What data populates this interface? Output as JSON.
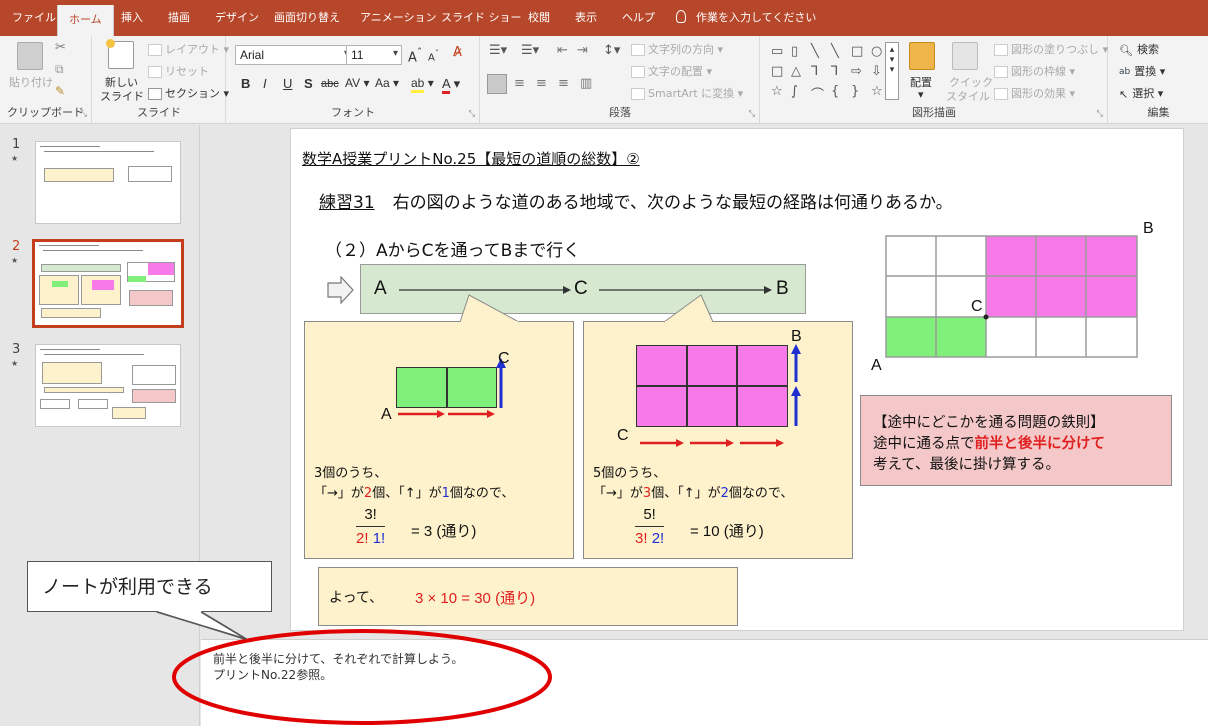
{
  "tabs": [
    {
      "label": "ファイル",
      "active": false
    },
    {
      "label": "ホーム",
      "active": true
    },
    {
      "label": "挿入",
      "active": false
    },
    {
      "label": "描画",
      "active": false
    },
    {
      "label": "デザイン",
      "active": false
    },
    {
      "label": "画面切り替え",
      "active": false
    },
    {
      "label": "アニメーション",
      "active": false
    },
    {
      "label": "スライド ショー",
      "active": false
    },
    {
      "label": "校閲",
      "active": false
    },
    {
      "label": "表示",
      "active": false
    },
    {
      "label": "ヘルプ",
      "active": false
    }
  ],
  "tell_me": "作業を入力してください",
  "ribbon": {
    "clipboard": {
      "label": "クリップボード",
      "paste": "貼り付け"
    },
    "slides": {
      "label": "スライド",
      "new_slide_1": "新しい",
      "new_slide_2": "スライド",
      "layout": "レイアウト",
      "reset": "リセット",
      "section": "セクション"
    },
    "font": {
      "label": "フォント",
      "name": "Arial",
      "size": "11",
      "b": "B",
      "i": "I",
      "u": "U",
      "s": "S",
      "abc": "abc",
      "spacing": "AV",
      "case": "Aa",
      "grow": "A",
      "shrink": "A",
      "color_a": "A"
    },
    "paragraph": {
      "label": "段落",
      "text_direction": "文字列の方向",
      "align_text": "文字の配置",
      "smartart": "SmartArt に変換"
    },
    "drawing": {
      "label": "図形描画",
      "arrange_1": "配置",
      "quick_1": "クイック",
      "quick_2": "スタイル",
      "fill": "図形の塗りつぶし",
      "outline": "図形の枠線",
      "effects": "図形の効果"
    },
    "editing": {
      "label": "編集",
      "find": "検索",
      "replace": "置換",
      "select": "選択"
    }
  },
  "thumbnails": [
    {
      "number": "1",
      "star": "★"
    },
    {
      "number": "2",
      "star": "★"
    },
    {
      "number": "3",
      "star": "★"
    }
  ],
  "slide": {
    "title": "数学A授業プリントNo.25【最短の道順の総数】②",
    "exercise_no": "練習31",
    "exercise_text": "右の図のような道のある地域で、次のような最短の経路は何通りあるか。",
    "sub_question": "（２）AからCを通ってBまで行く",
    "route": {
      "a": "A",
      "c": "C",
      "b": "B"
    },
    "left_box": {
      "label_c": "C",
      "label_a": "A",
      "line1": "3個のうち、",
      "line2_a": "「→」が",
      "line2_n1": "2",
      "line2_b": "個、「↑」が",
      "line2_n2": "1",
      "line2_c": "個なので、",
      "frac_num": "3!",
      "frac_den_1": "2!",
      "frac_den_2": "1!",
      "result": "= 3 (通り)"
    },
    "right_box": {
      "label_b": "B",
      "label_c": "C",
      "line1": "5個のうち、",
      "line2_a": "「→」が",
      "line2_n1": "3",
      "line2_b": "個、「↑」が",
      "line2_n2": "2",
      "line2_c": "個なので、",
      "frac_num": "5!",
      "frac_den_1": "3!",
      "frac_den_2": "2!",
      "result": "= 10 (通り)"
    },
    "grid": {
      "label_a": "A",
      "label_b": "B",
      "label_c": "C"
    },
    "rule": {
      "title": "【途中にどこかを通る問題の鉄則】",
      "line1_a": "途中に通る点で",
      "line1_b": "前半と後半に分けて",
      "line2": "考えて、最後に掛け算する。"
    },
    "conclusion": {
      "prefix": "よって、",
      "formula": "3 × 10 = 30 (通り)"
    }
  },
  "notes": {
    "line1": "前半と後半に分けて、それぞれで計算しよう。",
    "line2": "プリントNo.22参照。"
  },
  "callout": "ノートが利用できる",
  "colors": {
    "accent": "#b7472a",
    "green": "#80f07b",
    "pink": "#f77ae8",
    "red": "#e02020",
    "blue": "#1f2fd0"
  }
}
